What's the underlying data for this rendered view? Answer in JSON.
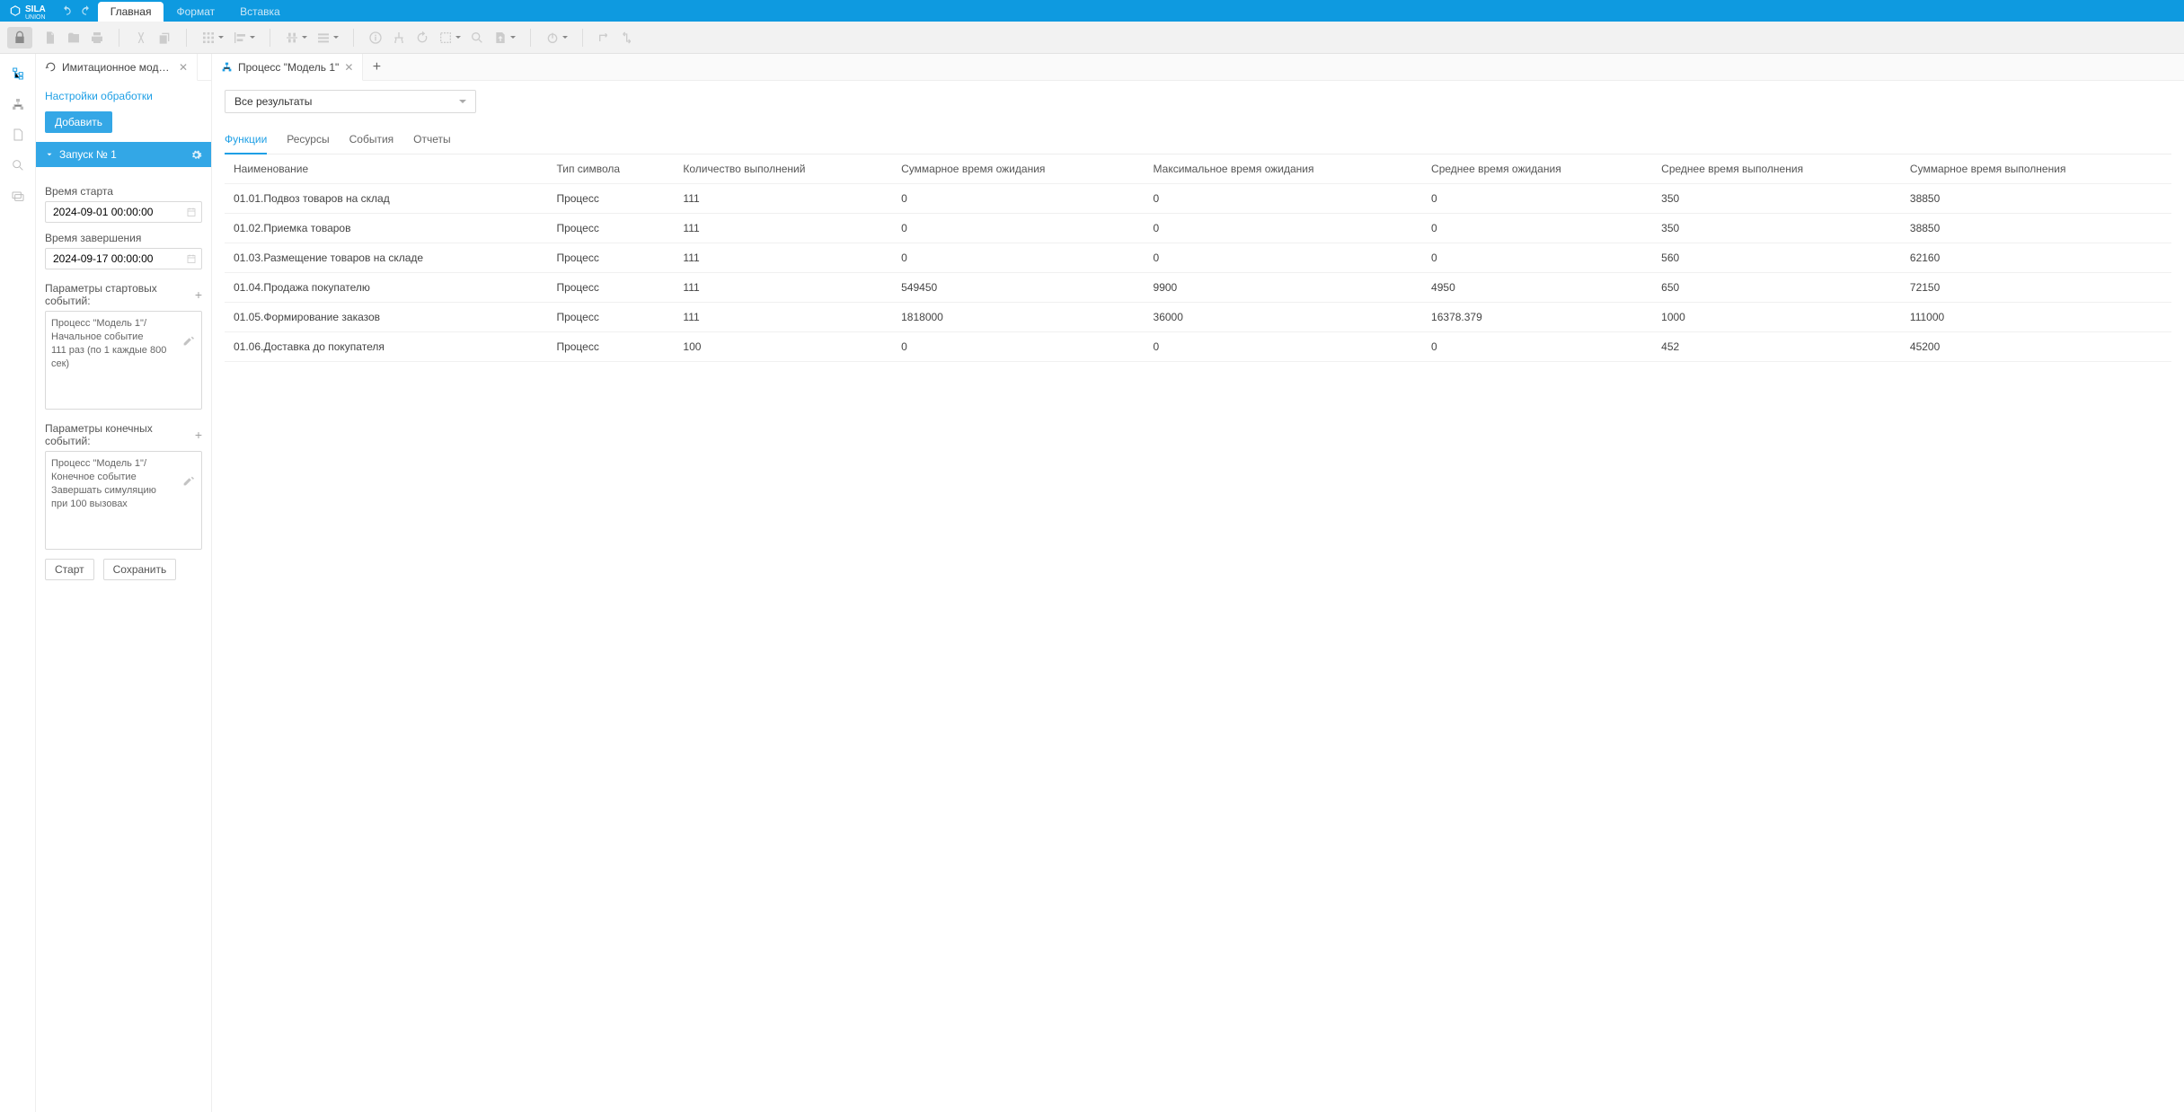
{
  "brand": {
    "name": "SILA",
    "sub": "UNION"
  },
  "topTabs": {
    "items": [
      "Главная",
      "Формат",
      "Вставка"
    ],
    "activeIndex": 0
  },
  "fileTabs": {
    "items": [
      {
        "label": "Имитационное модели...",
        "iconType": "loop"
      },
      {
        "label": "Процесс \"Модель 1\"",
        "iconType": "tree"
      }
    ]
  },
  "sidebar": {
    "settingsLink": "Настройки обработки",
    "addBtn": "Добавить",
    "runItem": "Запуск № 1",
    "startTimeLabel": "Время старта",
    "startTimeValue": "2024-09-01 00:00:00",
    "endTimeLabel": "Время завершения",
    "endTimeValue": "2024-09-17 00:00:00",
    "startParamsLabel": "Параметры стартовых событий:",
    "startParamsText": "Процесс \"Модель 1\"/\nНачальное событие\n111 раз (по 1 каждые 800 сек)",
    "endParamsLabel": "Параметры конечных событий:",
    "endParamsText": "Процесс \"Модель 1\"/\nКонечное событие\nЗавершать симуляцию при 100 вызовах",
    "startBtn": "Старт",
    "saveBtn": "Сохранить"
  },
  "results": {
    "filter": "Все результаты",
    "tabs": [
      "Функции",
      "Ресурсы",
      "События",
      "Отчеты"
    ],
    "activeTab": 0,
    "columns": [
      "Наименование",
      "Тип символа",
      "Количество выполнений",
      "Суммарное время ожидания",
      "Максимальное время ожидания",
      "Среднее время ожидания",
      "Среднее время выполнения",
      "Суммарное время выполнения"
    ],
    "rows": [
      [
        "01.01.Подвоз товаров на склад",
        "Процесс",
        "111",
        "0",
        "0",
        "0",
        "350",
        "38850"
      ],
      [
        "01.02.Приемка товаров",
        "Процесс",
        "111",
        "0",
        "0",
        "0",
        "350",
        "38850"
      ],
      [
        "01.03.Размещение товаров на складе",
        "Процесс",
        "111",
        "0",
        "0",
        "0",
        "560",
        "62160"
      ],
      [
        "01.04.Продажа покупателю",
        "Процесс",
        "111",
        "549450",
        "9900",
        "4950",
        "650",
        "72150"
      ],
      [
        "01.05.Формирование заказов",
        "Процесс",
        "111",
        "1818000",
        "36000",
        "16378.379",
        "1000",
        "111000"
      ],
      [
        "01.06.Доставка до покупателя",
        "Процесс",
        "100",
        "0",
        "0",
        "0",
        "452",
        "45200"
      ]
    ]
  }
}
